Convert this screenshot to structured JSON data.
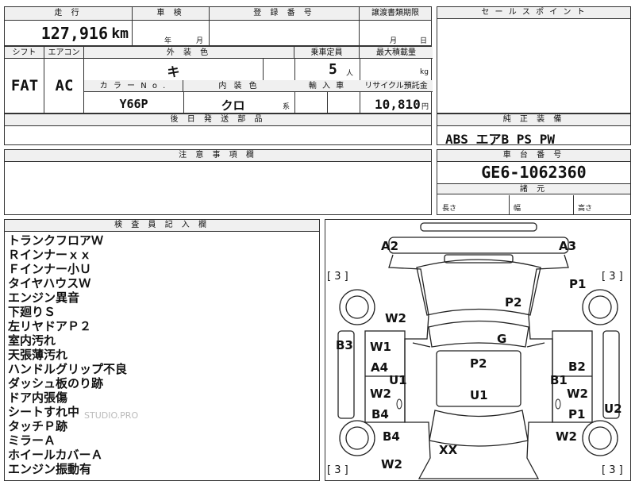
{
  "header": {
    "mileage_label": "走 行",
    "mileage_value": "127,916",
    "mileage_unit": "km",
    "inspection_label": "車 検",
    "inspection_year_unit": "年",
    "inspection_month_unit": "月",
    "registration_label": "登 録 番 号",
    "transfer_doc_label": "譲渡書類期限",
    "transfer_month_unit": "月",
    "transfer_day_unit": "日",
    "sales_point_label": "セ ー ル ス ポ イ ン ト"
  },
  "specs": {
    "shift_label": "シフト",
    "aircon_label": "エアコン",
    "shift_value": "FAT",
    "aircon_value": "AC",
    "exterior_color_label": "外 装 色",
    "exterior_color_value": "キ",
    "color_no_label": "カ ラ ー N o .",
    "color_no_value": "Y66P",
    "interior_color_label": "内 装 色",
    "interior_color_value": "クロ",
    "interior_color_suffix": "系",
    "capacity_label": "乗車定員",
    "capacity_value": "5",
    "capacity_unit": "人",
    "max_load_label": "最大積載量",
    "max_load_unit": "kg",
    "import_label": "輸 入 車",
    "recycle_label": "リサイクル預託金",
    "recycle_value": "10,810",
    "recycle_unit": "円"
  },
  "later_parts_label": "後 日 発 送 部 品",
  "genuine_equipment": {
    "label": "純 正 装 備",
    "value": "ABS エアB PS PW"
  },
  "notes_label": "注 意 事 項 欄",
  "chassis": {
    "label": "車 台 番 号",
    "value": "GE6-1062360"
  },
  "dimensions": {
    "label": "諸 元",
    "length_label": "長さ",
    "width_label": "幅",
    "height_label": "高さ"
  },
  "inspector": {
    "label": "検 査 員 記 入 欄",
    "items": [
      "トランクフロアＷ",
      "Ｒインナーｘｘ",
      "Ｆインナー小Ｕ",
      "タイヤハウスＷ",
      "エンジン異音",
      "下廻りＳ",
      "左リヤドアＰ２",
      "室内汚れ",
      "天張薄汚れ",
      "ハンドルグリップ不良",
      "ダッシュ板のり跡",
      "ドア内張傷",
      "シートすれ中",
      "タッチＰ跡",
      "ミラーＡ",
      "ホイールカバーＡ",
      "エンジン振動有"
    ],
    "watermark": "STUDIO.PRO"
  },
  "damage_map": {
    "tire_counts": [
      "[ 3 ]",
      "[ 3 ]",
      "[ 3 ]",
      "[ 3 ]"
    ],
    "marks": [
      "A2",
      "A3",
      "P1",
      "P2",
      "W2",
      "G",
      "B3",
      "W1",
      "A4",
      "U1",
      "P2",
      "B1",
      "B2",
      "W2",
      "U1",
      "B4",
      "W2",
      "P1",
      "U2",
      "B4",
      "W2",
      "XX",
      "W2"
    ]
  }
}
